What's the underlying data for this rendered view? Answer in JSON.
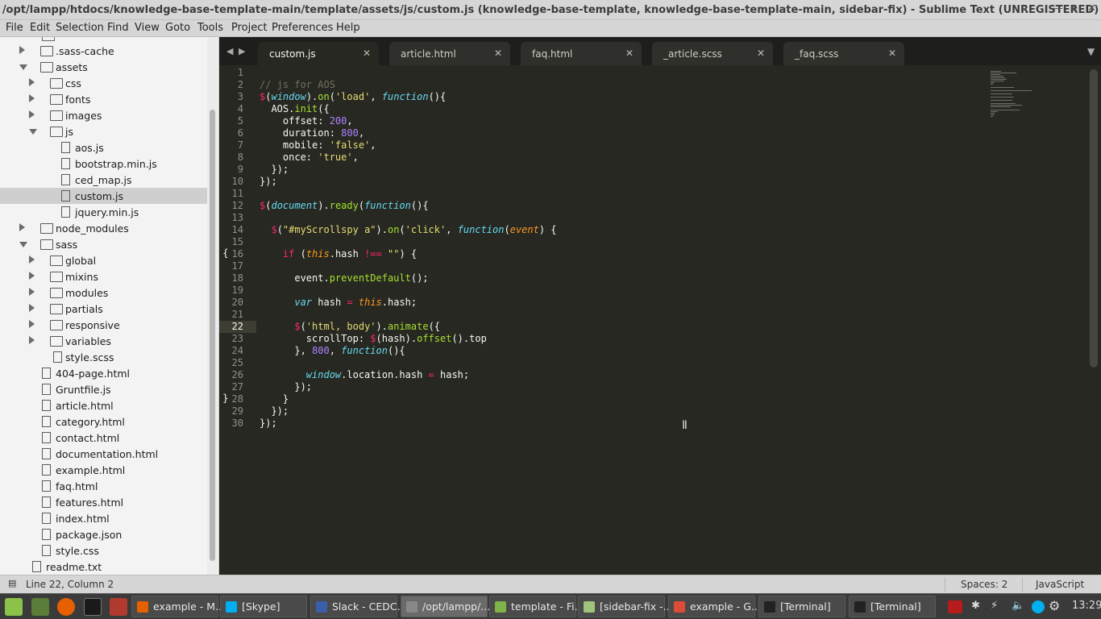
{
  "window": {
    "title": "/opt/lampp/htdocs/knowledge-base-template-main/template/assets/js/custom.js (knowledge-base-template, knowledge-base-template-main, sidebar-fix) - Sublime Text (UNREGISTERED)"
  },
  "menu": [
    "File",
    "Edit",
    "Selection",
    "Find",
    "View",
    "Goto",
    "Tools",
    "Project",
    "Preferences",
    "Help"
  ],
  "sidebar": {
    "items": [
      {
        "label": ".sass-cache",
        "type": "folder",
        "expanded": false
      },
      {
        "label": "assets",
        "type": "folder",
        "expanded": true
      },
      {
        "label": "css",
        "type": "folder",
        "expanded": false
      },
      {
        "label": "fonts",
        "type": "folder",
        "expanded": false
      },
      {
        "label": "images",
        "type": "folder",
        "expanded": false
      },
      {
        "label": "js",
        "type": "folder",
        "expanded": true
      },
      {
        "label": "aos.js",
        "type": "file"
      },
      {
        "label": "bootstrap.min.js",
        "type": "file"
      },
      {
        "label": "ced_map.js",
        "type": "file"
      },
      {
        "label": "custom.js",
        "type": "file",
        "selected": true
      },
      {
        "label": "jquery.min.js",
        "type": "file"
      },
      {
        "label": "node_modules",
        "type": "folder",
        "expanded": false
      },
      {
        "label": "sass",
        "type": "folder",
        "expanded": true
      },
      {
        "label": "global",
        "type": "folder",
        "expanded": false
      },
      {
        "label": "mixins",
        "type": "folder",
        "expanded": false
      },
      {
        "label": "modules",
        "type": "folder",
        "expanded": false
      },
      {
        "label": "partials",
        "type": "folder",
        "expanded": false
      },
      {
        "label": "responsive",
        "type": "folder",
        "expanded": false
      },
      {
        "label": "variables",
        "type": "folder",
        "expanded": false
      },
      {
        "label": "style.scss",
        "type": "file"
      },
      {
        "label": "404-page.html",
        "type": "file"
      },
      {
        "label": "Gruntfile.js",
        "type": "file"
      },
      {
        "label": "article.html",
        "type": "file"
      },
      {
        "label": "category.html",
        "type": "file"
      },
      {
        "label": "contact.html",
        "type": "file"
      },
      {
        "label": "documentation.html",
        "type": "file"
      },
      {
        "label": "example.html",
        "type": "file"
      },
      {
        "label": "faq.html",
        "type": "file"
      },
      {
        "label": "features.html",
        "type": "file"
      },
      {
        "label": "index.html",
        "type": "file"
      },
      {
        "label": "package.json",
        "type": "file"
      },
      {
        "label": "style.css",
        "type": "file"
      },
      {
        "label": "readme.txt",
        "type": "file"
      }
    ]
  },
  "tabs": [
    {
      "label": "custom.js",
      "active": true
    },
    {
      "label": "article.html",
      "active": false
    },
    {
      "label": "faq.html",
      "active": false
    },
    {
      "label": "_article.scss",
      "active": false
    },
    {
      "label": "_faq.scss",
      "active": false
    }
  ],
  "editor": {
    "current_line": 22,
    "lines": [
      [],
      [
        [
          "c",
          "// js for AOS"
        ]
      ],
      [
        [
          "k",
          "$"
        ],
        [
          "",
          "("
        ],
        [
          "i",
          "window"
        ],
        [
          "",
          ")."
        ],
        [
          "f",
          "on"
        ],
        [
          "",
          "("
        ],
        [
          "s",
          "'load'"
        ],
        [
          "",
          ", "
        ],
        [
          "i",
          "function"
        ],
        [
          "",
          "(){"
        ]
      ],
      [
        [
          "",
          "  AOS."
        ],
        [
          "f",
          "init"
        ],
        [
          "",
          "({"
        ]
      ],
      [
        [
          "",
          "    offset: "
        ],
        [
          "n",
          "200"
        ],
        [
          "",
          ","
        ]
      ],
      [
        [
          "",
          "    duration: "
        ],
        [
          "n",
          "800"
        ],
        [
          "",
          ","
        ]
      ],
      [
        [
          "",
          "    mobile: "
        ],
        [
          "s",
          "'false'"
        ],
        [
          "",
          ","
        ]
      ],
      [
        [
          "",
          "    once: "
        ],
        [
          "s",
          "'true'"
        ],
        [
          "",
          ","
        ]
      ],
      [
        [
          "",
          "  });"
        ]
      ],
      [
        [
          "",
          "});"
        ]
      ],
      [],
      [
        [
          "k",
          "$"
        ],
        [
          "",
          "("
        ],
        [
          "i",
          "document"
        ],
        [
          "",
          ")."
        ],
        [
          "f",
          "ready"
        ],
        [
          "",
          "("
        ],
        [
          "i",
          "function"
        ],
        [
          "",
          "(){"
        ]
      ],
      [],
      [
        [
          "",
          "  "
        ],
        [
          "k",
          "$"
        ],
        [
          "",
          "("
        ],
        [
          "s",
          "\"#myScrollspy a\""
        ],
        [
          "",
          ")."
        ],
        [
          "f",
          "on"
        ],
        [
          "",
          "("
        ],
        [
          "s",
          "'click'"
        ],
        [
          "",
          ", "
        ],
        [
          "i",
          "function"
        ],
        [
          "",
          "("
        ],
        [
          "p",
          "event"
        ],
        [
          "",
          ") {"
        ]
      ],
      [],
      [
        [
          "",
          "    "
        ],
        [
          "k",
          "if"
        ],
        [
          "",
          " ("
        ],
        [
          "p",
          "this"
        ],
        [
          "",
          ".hash "
        ],
        [
          "k",
          "!=="
        ],
        [
          "",
          " "
        ],
        [
          "s",
          "\"\""
        ],
        [
          "",
          ") {"
        ]
      ],
      [],
      [
        [
          "",
          "      event."
        ],
        [
          "f",
          "preventDefault"
        ],
        [
          "",
          "();"
        ]
      ],
      [],
      [
        [
          "",
          "      "
        ],
        [
          "i",
          "var"
        ],
        [
          "",
          " hash "
        ],
        [
          "k",
          "="
        ],
        [
          "",
          " "
        ],
        [
          "p",
          "this"
        ],
        [
          "",
          ".hash;"
        ]
      ],
      [],
      [
        [
          "",
          "      "
        ],
        [
          "k",
          "$"
        ],
        [
          "",
          "("
        ],
        [
          "s",
          "'html, body'"
        ],
        [
          "",
          ")."
        ],
        [
          "f",
          "animate"
        ],
        [
          "",
          "({"
        ]
      ],
      [
        [
          "",
          "        scrollTop: "
        ],
        [
          "k",
          "$"
        ],
        [
          "",
          "(hash)."
        ],
        [
          "f",
          "offset"
        ],
        [
          "",
          "().top"
        ]
      ],
      [
        [
          "",
          "      }, "
        ],
        [
          "n",
          "800"
        ],
        [
          "",
          ", "
        ],
        [
          "i",
          "function"
        ],
        [
          "",
          "(){"
        ]
      ],
      [],
      [
        [
          "",
          "        "
        ],
        [
          "i",
          "window"
        ],
        [
          "",
          ".location.hash "
        ],
        [
          "k",
          "="
        ],
        [
          "",
          " hash;"
        ]
      ],
      [
        [
          "",
          "      });"
        ]
      ],
      [
        [
          "",
          "    }"
        ]
      ],
      [
        [
          "",
          "  });"
        ]
      ],
      [
        [
          "",
          "});"
        ]
      ]
    ]
  },
  "status": {
    "position": "Line 22, Column 2",
    "spaces": "Spaces: 2",
    "syntax": "JavaScript"
  },
  "taskbar": {
    "windows": [
      {
        "label": "example - M...",
        "icon": "firefox-icon",
        "color": "#e66000",
        "active": false
      },
      {
        "label": "[Skype]",
        "icon": "skype-icon",
        "color": "#00aff0",
        "active": false
      },
      {
        "label": "Slack - CEDC...",
        "icon": "window-icon",
        "color": "#3a5fa8",
        "active": false
      },
      {
        "label": "/opt/lampp/...",
        "icon": "sublime-icon",
        "color": "#888888",
        "active": true
      },
      {
        "label": "template - Fi...",
        "icon": "folder-icon",
        "color": "#7fb347",
        "active": false
      },
      {
        "label": "[sidebar-fix -...",
        "icon": "file-icon",
        "color": "#9fc37a",
        "active": false
      },
      {
        "label": "example - G...",
        "icon": "chrome-icon",
        "color": "#dd4b39",
        "active": false
      },
      {
        "label": "[Terminal]",
        "icon": "terminal-icon",
        "color": "#222222",
        "active": false
      },
      {
        "label": "[Terminal]",
        "icon": "terminal-icon",
        "color": "#222222",
        "active": false
      }
    ],
    "clock": "13:29"
  }
}
